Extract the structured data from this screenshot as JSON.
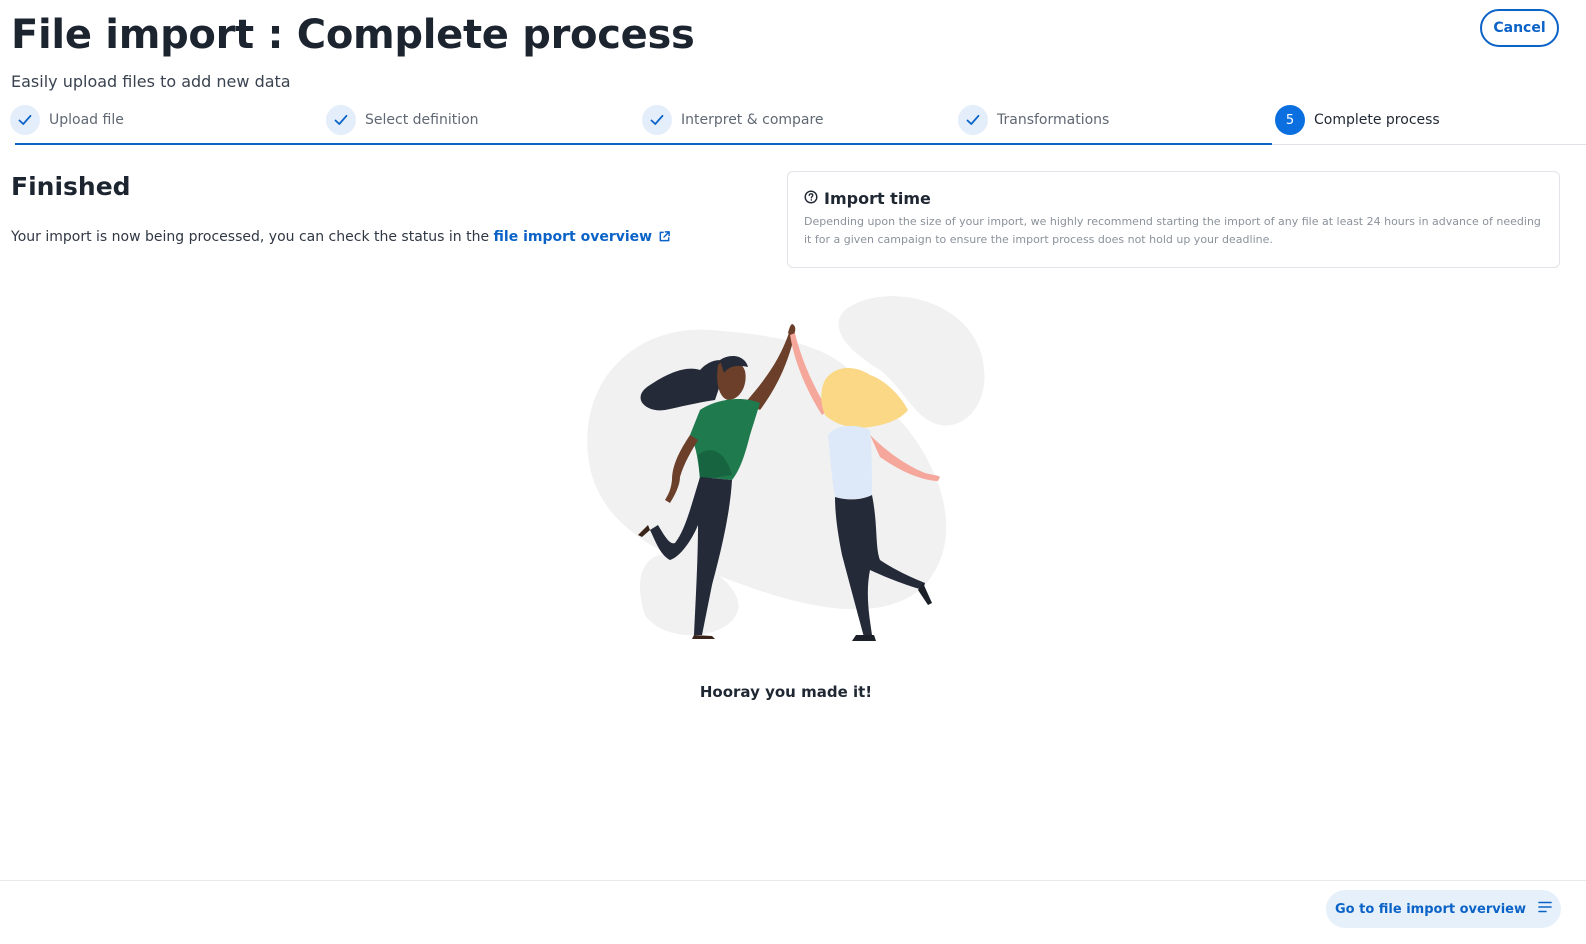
{
  "header": {
    "title": "File import : Complete process",
    "subtitle": "Easily upload files to add new data",
    "cancel_label": "Cancel"
  },
  "stepper": {
    "steps": [
      {
        "label": "Upload file",
        "status": "done",
        "icon": "check-icon"
      },
      {
        "label": "Select definition",
        "status": "done",
        "icon": "check-icon"
      },
      {
        "label": "Interpret & compare",
        "status": "done",
        "icon": "check-icon"
      },
      {
        "label": "Transformations",
        "status": "done",
        "icon": "check-icon"
      },
      {
        "label": "Complete process",
        "status": "active",
        "number": "5"
      }
    ],
    "progress": 0.8
  },
  "finished": {
    "heading": "Finished",
    "message": "Your import is now being processed, you can check the status in the",
    "link_label": "file import overview",
    "link_icon": "external-link-icon"
  },
  "info_card": {
    "icon": "question-circle-icon",
    "title": "Import time",
    "body": "Depending upon the size of your import, we highly recommend starting the import of any file at least 24 hours in advance of needing it for a given campaign to ensure the import process does not hold up your deadline."
  },
  "illustration": {
    "name": "high-five-illustration",
    "caption": "Hooray you made it!"
  },
  "footer": {
    "primary_label": "Go to file import overview",
    "primary_icon": "list-icon"
  },
  "colors": {
    "accent": "#0b63c7",
    "accent_active": "#0b6fe0",
    "accent_light": "#e3eefa",
    "text_dark": "#1c2430",
    "text_muted": "#8b929b"
  }
}
